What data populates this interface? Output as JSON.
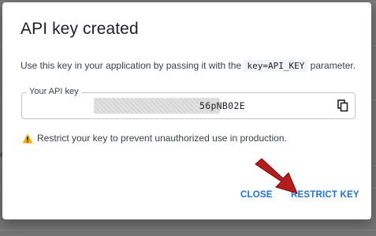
{
  "dialog": {
    "title": "API key created",
    "description_before": "Use this key in your application by passing it with the ",
    "description_code": "key=API_KEY",
    "description_after": " parameter.",
    "field_label": "Your API key",
    "key_visible_suffix": "56pNB02E",
    "warning_text": "Restrict your key to prevent unauthorized use in production.",
    "close_label": "CLOSE",
    "restrict_label": "RESTRICT KEY"
  },
  "colors": {
    "accent": "#1a73e8",
    "warning": "#f9ab00",
    "arrow": "#b71c1c"
  },
  "icons": {
    "copy": "copy-icon",
    "warning": "warning-triangle-icon",
    "annotation": "red-arrow-icon"
  },
  "background": {
    "partial_text": "e"
  }
}
